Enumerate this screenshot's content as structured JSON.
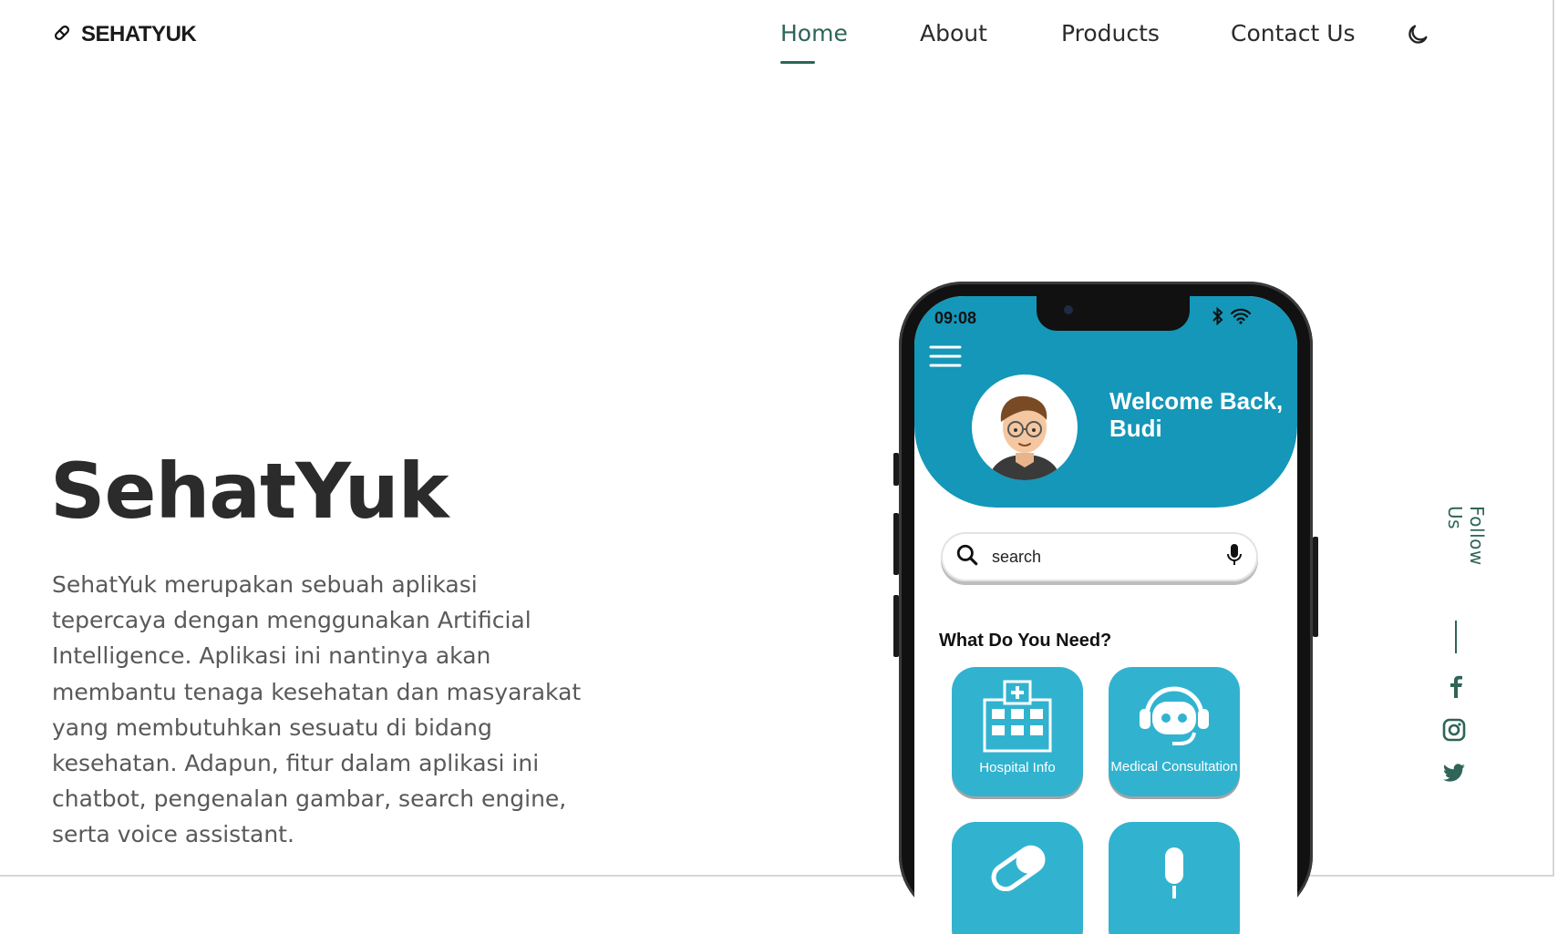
{
  "brand": {
    "name": "SEHATYUK",
    "icon": "pill-icon"
  },
  "nav": {
    "items": [
      {
        "label": "Home",
        "active": true
      },
      {
        "label": "About",
        "active": false
      },
      {
        "label": "Products",
        "active": false
      },
      {
        "label": "Contact Us",
        "active": false
      }
    ],
    "theme_icon": "moon-icon"
  },
  "hero": {
    "title": "SehatYuk",
    "description": "SehatYuk merupakan sebuah aplikasi tepercaya dengan menggunakan Artificial Intelligence. Aplikasi ini nantinya akan membantu tenaga kesehatan dan masyarakat yang membutuhkan sesuatu di bidang kesehatan. Adapun, fitur dalam aplikasi ini chatbot, pengenalan gambar, search engine, serta voice assistant."
  },
  "phone": {
    "time": "09:08",
    "welcome": "Welcome Back, Budi",
    "search_placeholder": "search",
    "section_title": "What Do You Need?",
    "tiles": [
      {
        "label": "Hospital Info",
        "icon": "hospital-icon"
      },
      {
        "label": "Medical Consultation",
        "icon": "chatbot-icon"
      },
      {
        "label": "",
        "icon": "pill-icon"
      },
      {
        "label": "",
        "icon": "microphone-icon"
      }
    ]
  },
  "follow": {
    "label": "Follow Us",
    "socials": [
      "facebook-icon",
      "instagram-icon",
      "twitter-icon"
    ]
  },
  "colors": {
    "accent": "#2f6458",
    "app_blue": "#1497b9",
    "tile_blue": "#31b3d0"
  }
}
